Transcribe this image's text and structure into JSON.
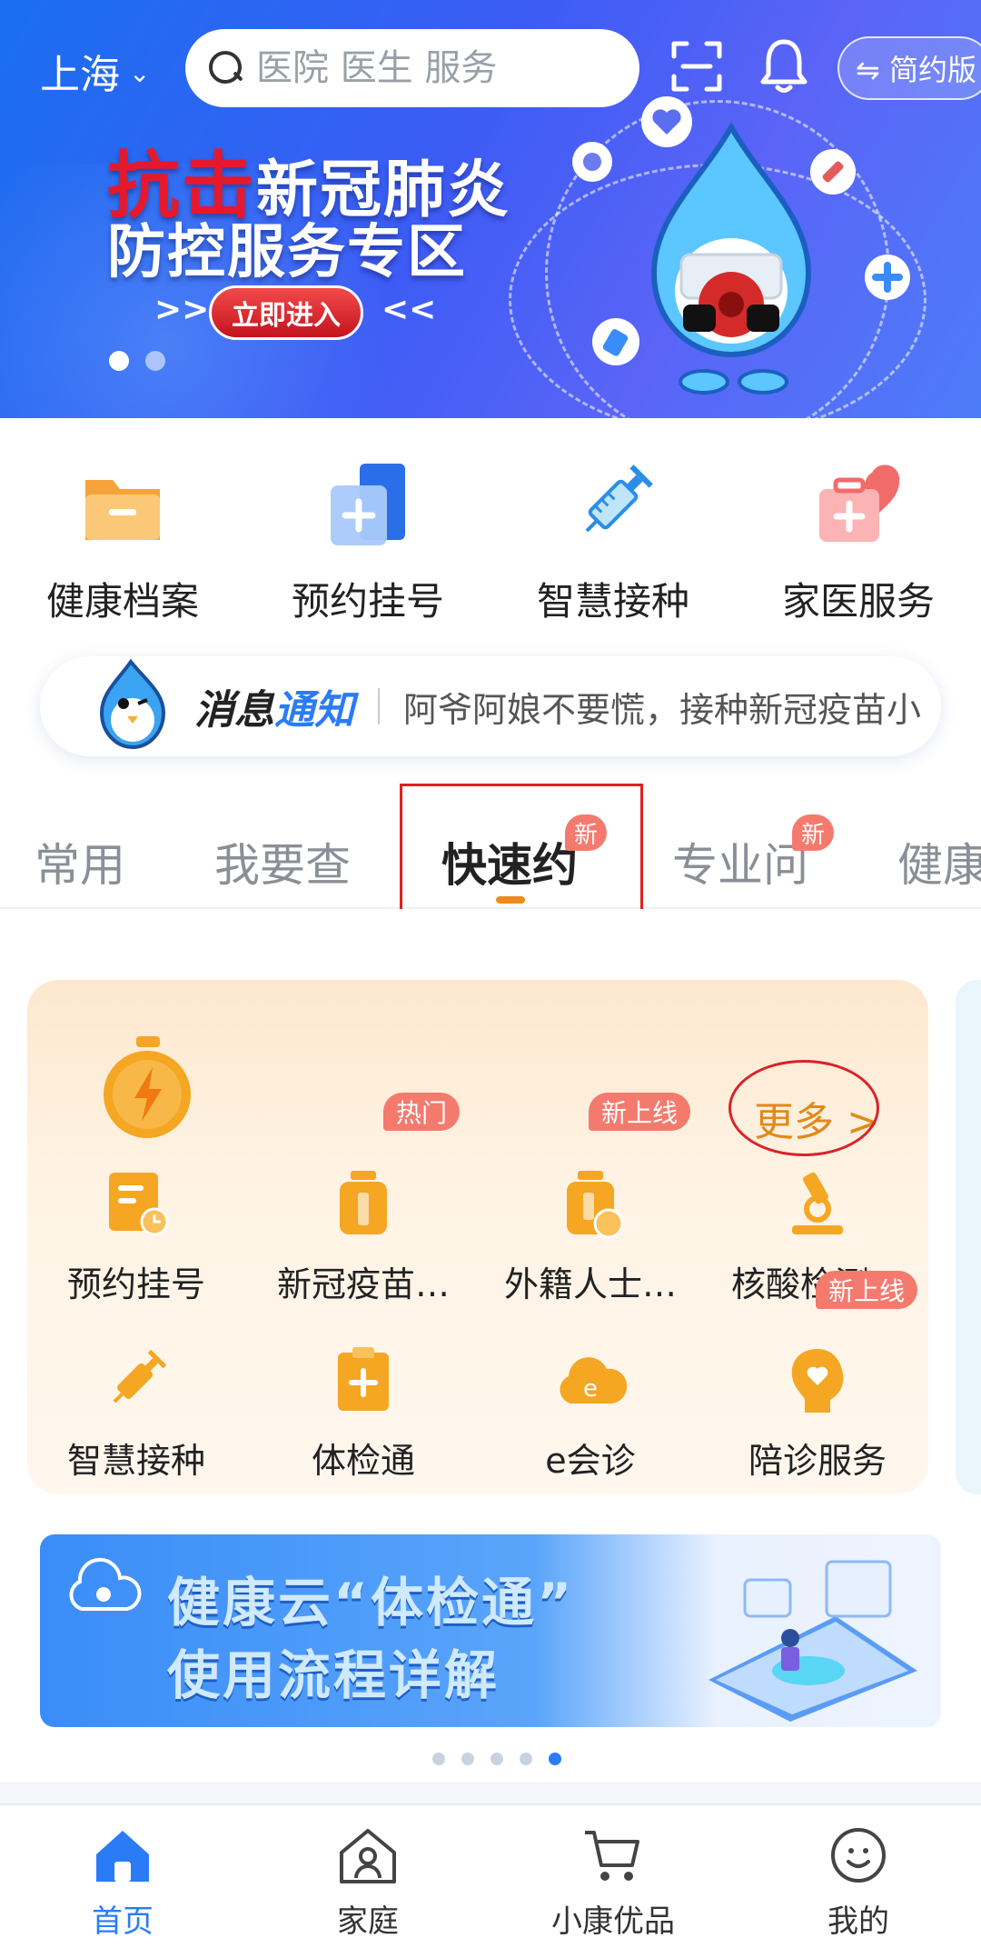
{
  "header": {
    "city": "上海",
    "search_placeholder": "医院 医生 服务",
    "mode_button": "⇋ 简约版"
  },
  "hero": {
    "headline_red": "抗击",
    "headline_rest": "新冠肺炎",
    "headline2": "防控服务专区",
    "enter_button": "立即进入",
    "arrow_left": ">>",
    "arrow_right": "<<",
    "slide_total": 2,
    "slide_active": 1
  },
  "quick_entries": [
    {
      "label": "健康档案",
      "icon": "folder-icon"
    },
    {
      "label": "预约挂号",
      "icon": "register-icon"
    },
    {
      "label": "智慧接种",
      "icon": "syringe-icon"
    },
    {
      "label": "家医服务",
      "icon": "medical-kit-icon"
    }
  ],
  "notice": {
    "title_a": "消息",
    "title_b": "通知",
    "message": "阿爷阿娘不要慌，接种新冠疫苗小"
  },
  "tabs": [
    {
      "label": "常用",
      "badge": ""
    },
    {
      "label": "我要查",
      "badge": ""
    },
    {
      "label": "快速约",
      "badge": "新",
      "active": true
    },
    {
      "label": "专业问",
      "badge": "新"
    },
    {
      "label": "健康",
      "badge": ""
    }
  ],
  "service_card": {
    "more_label": "更多 >",
    "items": [
      {
        "label": "预约挂号",
        "badge": "",
        "icon": "appointment-icon"
      },
      {
        "label": "新冠疫苗…",
        "badge": "热门",
        "icon": "vaccine-bottle-icon"
      },
      {
        "label": "外籍人士…",
        "badge": "新上线",
        "icon": "foreign-vaccine-icon"
      },
      {
        "label": "核酸检测…",
        "badge": "",
        "icon": "microscope-icon"
      },
      {
        "label": "智慧接种",
        "badge": "",
        "icon": "syringe-icon"
      },
      {
        "label": "体检通",
        "badge": "",
        "icon": "clipboard-icon"
      },
      {
        "label": "e会诊",
        "badge": "",
        "icon": "cloud-e-icon"
      },
      {
        "label": "陪诊服务",
        "badge": "新上线",
        "icon": "head-heart-icon"
      }
    ]
  },
  "promo": {
    "line1": "健康云“体检通”",
    "line2": "使用流程详解",
    "dot_total": 5,
    "dot_active": 5
  },
  "bottom_nav": [
    {
      "label": "首页",
      "icon": "home-icon",
      "active": true
    },
    {
      "label": "家庭",
      "icon": "family-icon"
    },
    {
      "label": "小康优品",
      "icon": "cart-icon"
    },
    {
      "label": "我的",
      "icon": "profile-icon"
    }
  ],
  "colors": {
    "primary_blue": "#2a7cf6",
    "orange_accent": "#f08a1c",
    "badge_red": "#f47a6e",
    "annotation_red": "#e02020"
  }
}
